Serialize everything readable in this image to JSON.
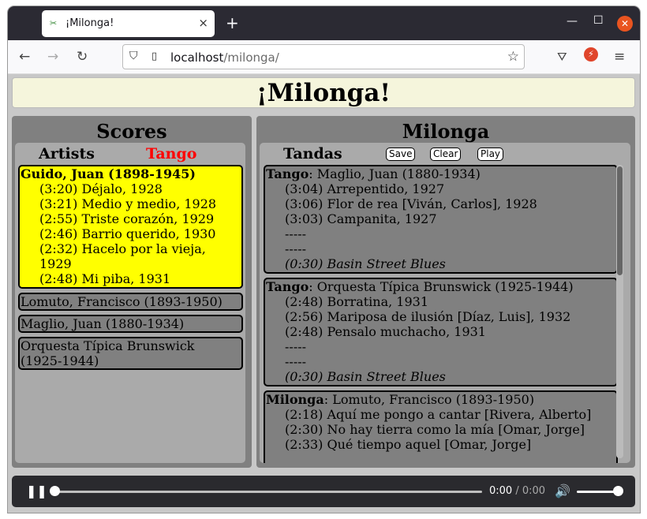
{
  "browser": {
    "tab_title": "¡Milonga!",
    "tab_close": "×",
    "new_tab": "+",
    "url_host": "localhost",
    "url_path": "/milonga/",
    "icons": [
      "back-arrow-icon",
      "forward-arrow-icon",
      "reload-icon",
      "shield-icon",
      "page-icon",
      "star-icon",
      "pocket-icon",
      "extension-icon",
      "menu-icon"
    ]
  },
  "page": {
    "title": "¡Milonga!"
  },
  "scores": {
    "title": "Scores",
    "tab_artists": "Artists",
    "tab_tango": "Tango",
    "tab_tango_color": "#ff0000",
    "expanded_artist": {
      "name": "Guido, Juan (1898-1945)",
      "tracks": [
        "(3:20) Déjalo, 1928",
        "(3:21) Medio y medio, 1928",
        "(2:55) Triste corazón, 1929",
        "(2:46) Barrio querido, 1930",
        "(2:32) Hacelo por la vieja,",
        "1929",
        "(2:48) Mi piba, 1931"
      ]
    },
    "artists": [
      "Lomuto, Francisco (1893-1950)",
      "Maglio, Juan (1880-1934)",
      "Orquesta Típica Brunswick",
      "(1925-1944)"
    ]
  },
  "milonga": {
    "title": "Milonga",
    "tandas_label": "Tandas",
    "save_label": "Save",
    "clear_label": "Clear",
    "play_label": "Play",
    "tandas": [
      {
        "type": "Tango",
        "orchestra": ": Maglio, Juan (1880-1934)",
        "tracks": [
          "(3:04) Arrepentido, 1927",
          "(3:06) Flor de rea [Viván, Carlos], 1928",
          "(3:03) Campanita, 1927",
          "-----",
          "-----"
        ],
        "cortina": "(0:30) Basin Street Blues"
      },
      {
        "type": "Tango",
        "orchestra": ": Orquesta Típica Brunswick (1925-1944)",
        "tracks": [
          "(2:48) Borratina, 1931",
          "(2:56) Mariposa de ilusión [Díaz, Luis], 1932",
          "(2:48) Pensalo muchacho, 1931",
          "-----",
          "-----"
        ],
        "cortina": "(0:30) Basin Street Blues"
      },
      {
        "type": "Milonga",
        "orchestra": ": Lomuto, Francisco (1893-1950)",
        "tracks": [
          "(2:18) Aquí me pongo a cantar [Rivera, Alberto]",
          "(2:30) No hay tierra como la mía [Omar, Jorge]",
          "(2:33) Qué tiempo aquel [Omar, Jorge]"
        ]
      }
    ]
  },
  "audio": {
    "current_time": "0:00",
    "separator": " / ",
    "duration": "0:00",
    "progress": 0,
    "volume": 1.0
  }
}
